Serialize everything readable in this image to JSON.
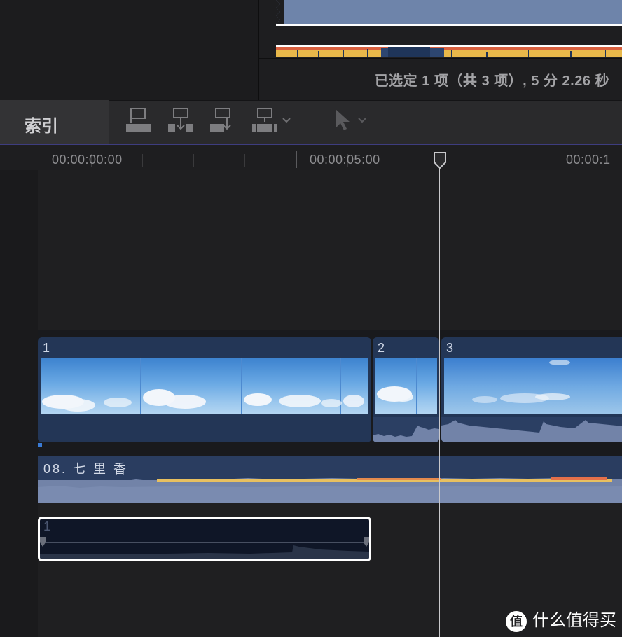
{
  "viewer": {
    "selection_status": "已选定 1 项（共 3 项）, 5 分 2.26 秒"
  },
  "toolbar": {
    "index_tab_label": "索引",
    "icons": [
      "connect-clip-icon",
      "insert-clip-icon",
      "append-clip-icon",
      "overwrite-clip-icon",
      "select-tool-icon"
    ]
  },
  "ruler": {
    "timecodes": [
      "00:00:00:00",
      "00:00:05:00",
      "00:00:1"
    ]
  },
  "timeline": {
    "clips": [
      {
        "label": "1"
      },
      {
        "label": "2"
      },
      {
        "label": "3"
      }
    ],
    "music_clip": {
      "label": "08. 七 里 香"
    },
    "connected_clip": {
      "label": "1"
    }
  },
  "colors": {
    "clip_blue": "#233656",
    "audio_blue": "#7283a8",
    "selection_white": "#ffffff",
    "timeline_accent": "#3e3d80"
  },
  "watermark": {
    "logo_char": "值",
    "text": "什么值得买"
  }
}
